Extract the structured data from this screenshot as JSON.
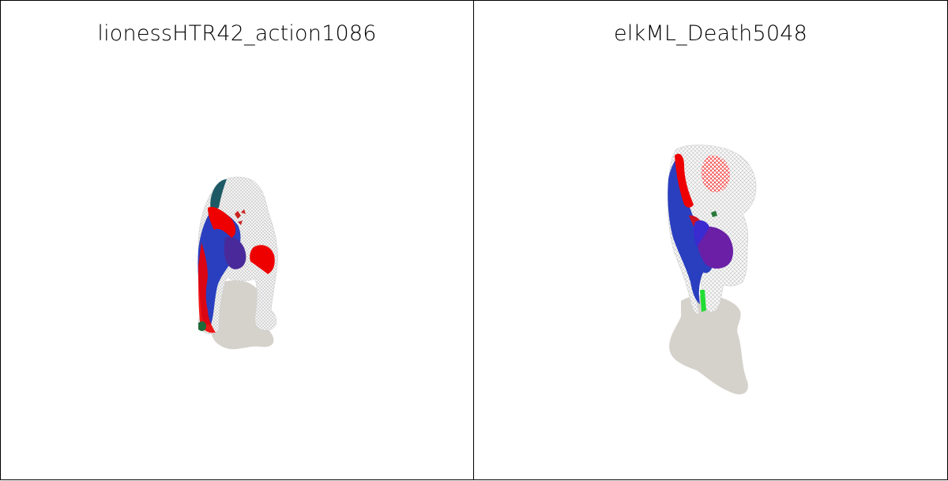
{
  "panels": [
    {
      "title": "lionessHTR42_action1086",
      "model": "lioness-mesh",
      "colors": {
        "wireframe": "#d9d9d9",
        "shadow": "#d5d2cb",
        "blue": "#2a3fbf",
        "red": "#ee0000",
        "teal": "#1d5a66",
        "green": "#1e6b3a"
      }
    },
    {
      "title": "elkML_Death5048",
      "model": "elk-mesh",
      "colors": {
        "wireframe": "#d9d9d9",
        "shadow": "#d5d2cb",
        "blue": "#2a3fbf",
        "red": "#ee0000",
        "purple": "#6a1fa6",
        "green": "#22dd33"
      }
    }
  ]
}
